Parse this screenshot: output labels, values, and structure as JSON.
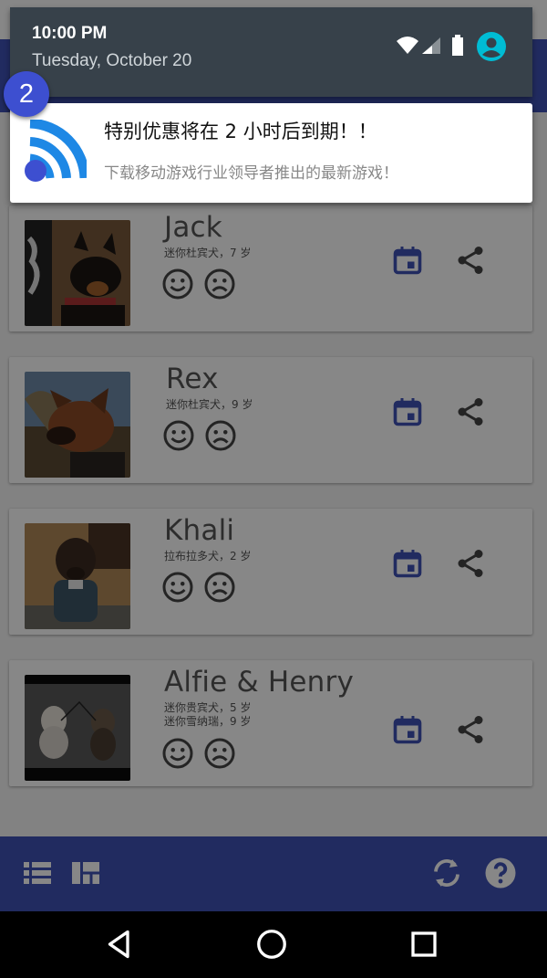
{
  "status_bar": {
    "time": "10:00 PM",
    "date": "Tuesday, October 20"
  },
  "notification": {
    "badge_count": "2",
    "title": "特别优惠将在 2 小时后到期！！",
    "body": "下载移动游戏行业领导者推出的最新游戏！"
  },
  "colors": {
    "primary": "#3f51b5",
    "accent": "#00bcd4",
    "badge": "#3d4fd0"
  },
  "dogs": [
    {
      "name": "Jack",
      "breed_lines": [
        "迷你杜宾犬，7 岁"
      ]
    },
    {
      "name": "Rex",
      "breed_lines": [
        "迷你杜宾犬，9 岁"
      ]
    },
    {
      "name": "Khali",
      "breed_lines": [
        "拉布拉多犬，2 岁"
      ]
    },
    {
      "name": "Alfie & Henry",
      "breed_lines": [
        "迷你贵宾犬，5 岁",
        "迷你雪纳瑞，9 岁"
      ]
    }
  ],
  "card_icons": [
    "smile-icon",
    "frown-icon",
    "calendar-icon",
    "share-icon"
  ],
  "bottom_bar_icons": [
    "list-view-icon",
    "grid-view-icon",
    "refresh-icon",
    "help-icon"
  ],
  "nav_icons": [
    "back-icon",
    "home-icon",
    "recents-icon"
  ]
}
